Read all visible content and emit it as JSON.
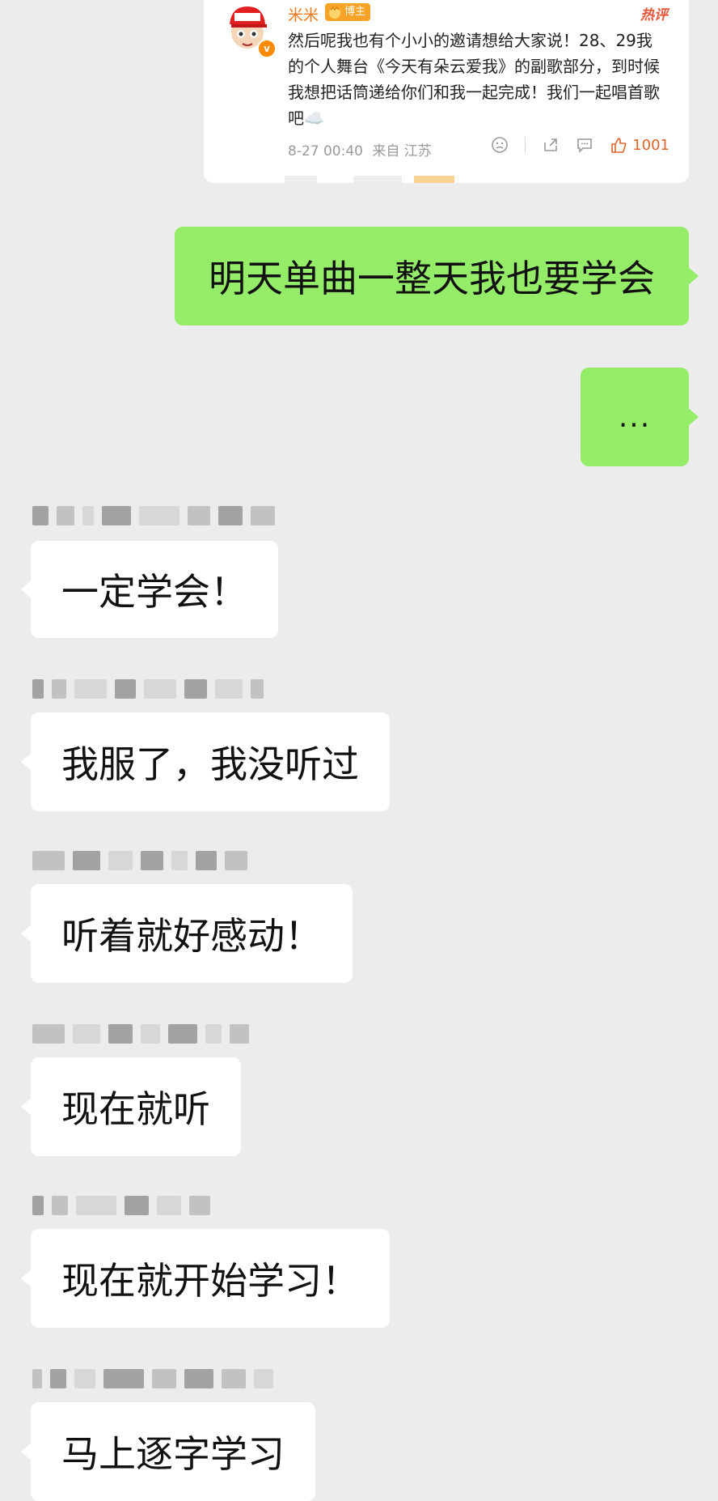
{
  "post": {
    "username": "米米",
    "badge": "博主",
    "hot_label": "热评",
    "text": "然后呢我也有个小小的邀请想给大家说！28、29我的个人舞台《今天有朵云爱我》的副歌部分，到时候我想把话筒递给你们和我一起完成！我们一起唱首歌吧☁️",
    "timestamp": "8-27 00:40",
    "location": "来自 江苏",
    "likes": "1001",
    "icons": [
      "avatar-cartoon",
      "verified-badge-icon",
      "dislike-face-icon",
      "share-icon",
      "comment-icon",
      "thumbs-up-icon"
    ]
  },
  "chat": {
    "outgoing": [
      {
        "text": "明天单曲一整天我也要学会"
      },
      {
        "text": "..."
      }
    ],
    "incoming": [
      {
        "text": "一定学会！"
      },
      {
        "text": "我服了，我没听过"
      },
      {
        "text": "听着就好感动！"
      },
      {
        "text": "现在就听"
      },
      {
        "text": "现在就开始学习！"
      },
      {
        "text": "马上逐字学习"
      }
    ]
  },
  "colors": {
    "outgoing_bubble": "#95ec69",
    "incoming_bubble": "#ffffff",
    "background": "#ececec",
    "username": "#f07a1a",
    "like": "#e0642a"
  }
}
